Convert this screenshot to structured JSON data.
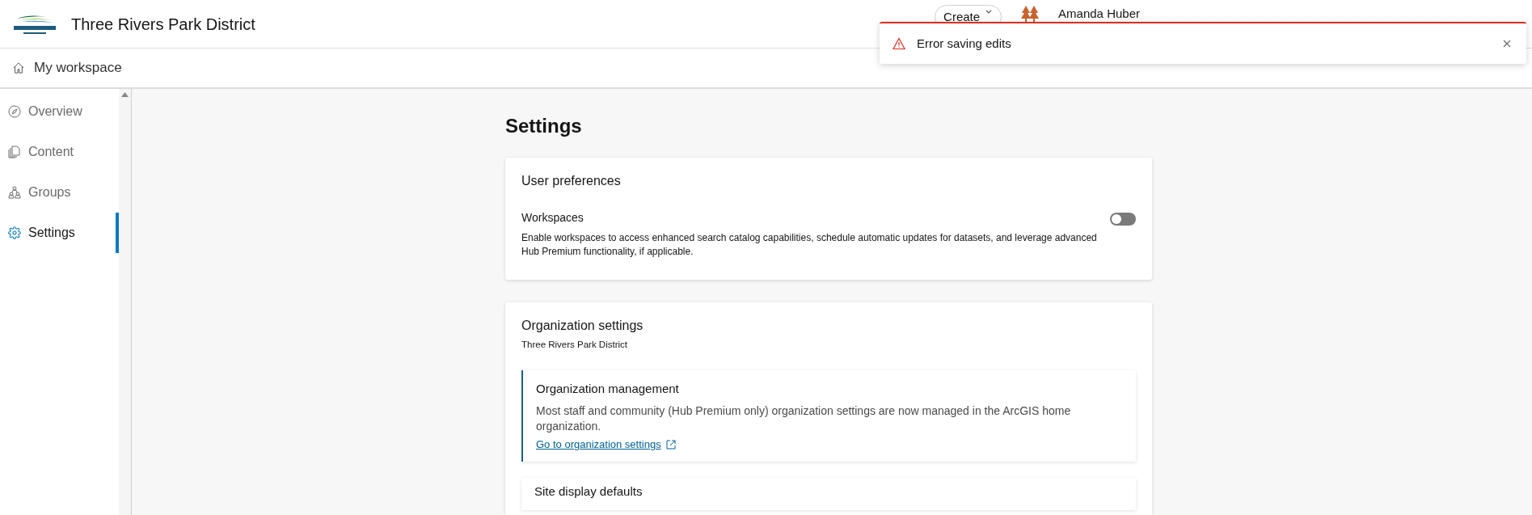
{
  "header": {
    "title": "Three Rivers Park District",
    "create_button": "Create",
    "user_name": "Amanda Huber"
  },
  "toast": {
    "message": "Error saving edits"
  },
  "breadcrumb": {
    "label": "My workspace"
  },
  "sidebar": {
    "items": [
      {
        "label": "Overview",
        "selected": false
      },
      {
        "label": "Content",
        "selected": false
      },
      {
        "label": "Groups",
        "selected": false
      },
      {
        "label": "Settings",
        "selected": true
      }
    ]
  },
  "page": {
    "title": "Settings",
    "user_preferences": {
      "title": "User preferences",
      "setting": {
        "label": "Workspaces",
        "description": "Enable workspaces to access enhanced search catalog capabilities, schedule automatic updates for datasets, and leverage advanced Hub Premium functionality, if applicable.",
        "on": false
      }
    },
    "organization_settings": {
      "title": "Organization settings",
      "subtitle": "Three Rivers Park District",
      "notice": {
        "title": "Organization management",
        "text": "Most staff and community (Hub Premium only) organization settings are now managed in the ArcGIS home organization.",
        "link": "Go to organization settings"
      }
    },
    "next_section": {
      "title": "Site display defaults"
    }
  }
}
